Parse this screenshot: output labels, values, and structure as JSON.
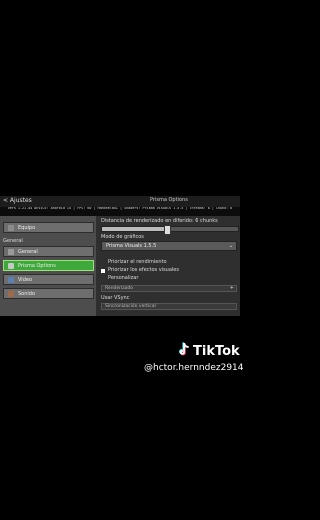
{
  "topbar": {
    "back_label": "< Ajustes",
    "title": "Prisma Options"
  },
  "debug_text": "Vers 1.21.44  DEVICE: Android 14 | FPS: 60 | HandheldXL | Shaders: Prisma Visuals 1.5.5 | Threads: 8 | Chunk: 6",
  "sidebar": {
    "items": [
      {
        "label": "Equipo"
      },
      {
        "label": "General"
      },
      {
        "label": "Prisma Options"
      },
      {
        "label": "Video"
      },
      {
        "label": "Sonido"
      }
    ],
    "section_label": "General"
  },
  "main": {
    "render_distance": "Distancia de renderizado en diferido: 6 chunks",
    "render_value": 0.48,
    "graphics_mode_label": "Modo de gráficos",
    "graphics_mode_value": "Prisma Visuals 1.5.5",
    "options": [
      "Priorizar el rendimiento",
      "Priorizar los efectos visuales",
      "Personalizar"
    ],
    "selected_option": 1,
    "collapsed_bar": "Renderizado",
    "vsync_label": "Usar VSync",
    "vsync_bar": "Sincronización vertical"
  },
  "tiktok": {
    "brand": "TikTok",
    "username": "@hctor.hernndez2914"
  }
}
